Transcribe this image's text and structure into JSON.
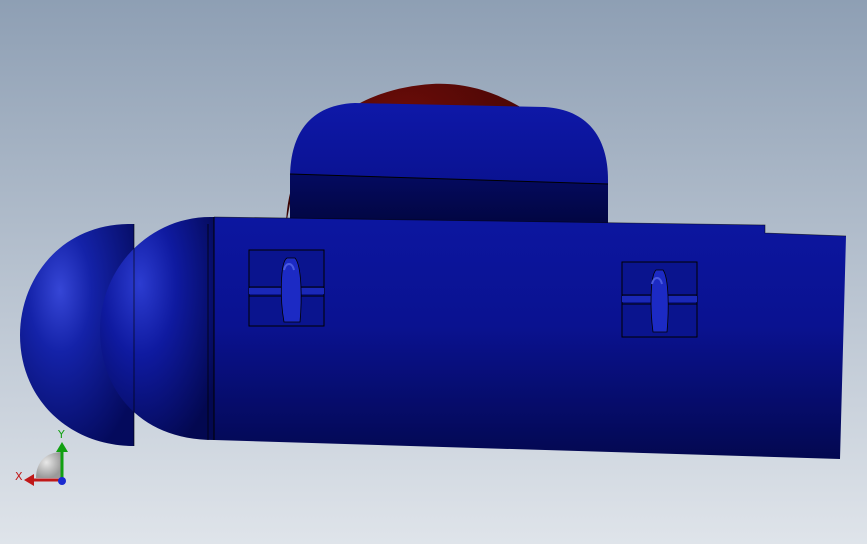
{
  "viewport": {
    "background_top": "#8e9fb4",
    "background_bottom": "#dde3ea"
  },
  "model": {
    "body_color": "#0a128c",
    "body_dark": "#020640",
    "body_light": "#2a3ad0",
    "back_part_color": "#5a0a08"
  },
  "triad": {
    "x_label": "X",
    "y_label": "Y",
    "x_color": "#c01818",
    "y_color": "#12a012",
    "z_color": "#1a2ad0"
  }
}
